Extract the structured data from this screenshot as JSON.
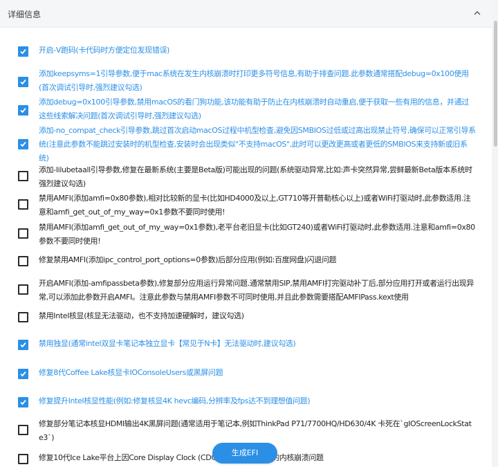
{
  "header": {
    "title": "详细信息"
  },
  "colors": {
    "accent": "#2b8fe6",
    "text_default": "#222222"
  },
  "options": [
    {
      "checked": true,
      "label": "开启-V跑码(卡代码时方便定位发现错误)"
    },
    {
      "checked": true,
      "label": "添加keepsyms=1引导参数,便于mac系统在发生内核崩溃时打印更多符号信息,有助于排查问题.此参数通常搭配debug=0x100使用(首次调试引导时,强烈建议勾选)"
    },
    {
      "checked": true,
      "label": "添加debug=0x100引导参数,禁用macOS的看门狗功能,该功能有助于防止在内核崩溃时自动重启,便于获取一些有用的信息，并通过这些线索解决问题(首次调试引导时,强烈建议勾选)"
    },
    {
      "checked": true,
      "label": "添加-no_compat_check引导参数,跳过首次启动macOS过程中机型检查,避免因SMBIOS过低或过高出现禁止符号,确保可以正常引导系统(注意此参数不能跳过安装时的机型检查,安装时会出现类似\"不支持macOS\",此时可以更改更高或者更低的SMBIOS来支持新或旧系统)"
    },
    {
      "checked": false,
      "label": "添加-lilubetaall引导参数,修复在最新系统(主要是Beta版)可能出现的问题(系统驱动异常,比如:声卡突然异常,尝鲜最新Beta版本系统时强烈建议勾选)"
    },
    {
      "checked": false,
      "label": "禁用AMFI(添加amfi=0x80参数),相对比较新的显卡(比如HD4000及以上,GT710等开普勒核心以上)或者WiFi打驱动时,此参数适用.注意和amfi_get_out_of_my_way=0x1参数不要同时使用!"
    },
    {
      "checked": false,
      "label": "禁用AMFI(添加amfi_get_out_of_my_way=0x1参数),老平台老旧显卡(比如GT240)或者WiFi打驱动时,此参数适用.注意和amfi=0x80参数不要同时使用!"
    },
    {
      "checked": false,
      "label": "修复禁用AMFI(添加ipc_control_port_options=0参数)后部分应用(例如:百度网盘)闪退问题"
    },
    {
      "checked": false,
      "label": "开启AMFI(添加-amfipassbeta参数),修复部分应用运行异常问题.通常禁用SIP,禁用AMFI打完驱动补丁后,部分应用打开或者运行出现异常,可以添加此参数开启AMFI。注意此参数与禁用AMFI参数不可同时使用,并且此参数需要搭配AMFIPass.kext使用"
    },
    {
      "checked": false,
      "label": "禁用Intel核显(核显无法驱动，也不支持加速硬解时，建议勾选)"
    },
    {
      "checked": true,
      "label": "禁用独显(通常intel双显卡笔记本独立显卡【常见于N卡】无法驱动时,建议勾选)"
    },
    {
      "checked": true,
      "label": "修复8代Coffee Lake核显卡IOConsoleUsers或黑屏问题"
    },
    {
      "checked": true,
      "label": "修复提升Intel核显性能(例如:修复核显4K hevc编码,分辨率及fps达不到理想值问题)"
    },
    {
      "checked": false,
      "label": "修复部分笔记本核显HDMI输出4K黑屏问题(通常适用于笔记本,例如ThinkPad P71/7700HQ/HD630/4K 卡死在`gIOScreenLockState3`)"
    },
    {
      "checked": false,
      "label": "修复10代Ice Lake平台上因Core Display Clock (CDCLK)频率过低导致的内核崩溃问题"
    }
  ],
  "footer": {
    "generate_label": "生成EFI"
  }
}
